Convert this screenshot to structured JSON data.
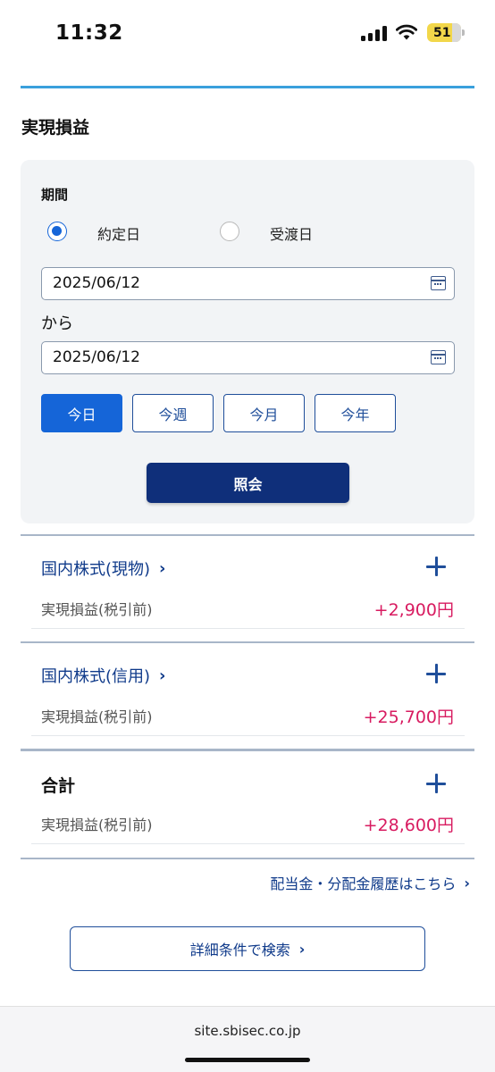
{
  "status_bar": {
    "time": "11:32",
    "battery": "51",
    "icons": [
      "signal-icon",
      "wifi-icon",
      "battery-icon"
    ]
  },
  "page": {
    "section_title": "実現損益"
  },
  "filter": {
    "period_label": "期間",
    "radio_options": [
      {
        "label": "約定日",
        "checked": true
      },
      {
        "label": "受渡日",
        "checked": false
      }
    ],
    "from_date": "2025/06/12",
    "from_text": "から",
    "to_date": "2025/06/12",
    "quick_buttons": [
      {
        "label": "今日",
        "active": true
      },
      {
        "label": "今週",
        "active": false
      },
      {
        "label": "今月",
        "active": false
      },
      {
        "label": "今年",
        "active": false
      }
    ],
    "query_button": "照会"
  },
  "results": [
    {
      "category": "国内株式(現物)",
      "label": "実現損益(税引前)",
      "value": "+2,900円"
    },
    {
      "category": "国内株式(信用)",
      "label": "実現損益(税引前)",
      "value": "+25,700円"
    }
  ],
  "total": {
    "category": "合計",
    "label": "実現損益(税引前)",
    "value": "+28,600円"
  },
  "links": {
    "dividend_history": "配当金・分配金履歴はこちら",
    "detail_search": "詳細条件で検索"
  },
  "browser": {
    "domain": "site.sbisec.co.jp"
  },
  "colors": {
    "accent": "#1565d8",
    "navy": "#0f2f7a",
    "link": "#0f3a8a",
    "positive": "#d81b60"
  }
}
